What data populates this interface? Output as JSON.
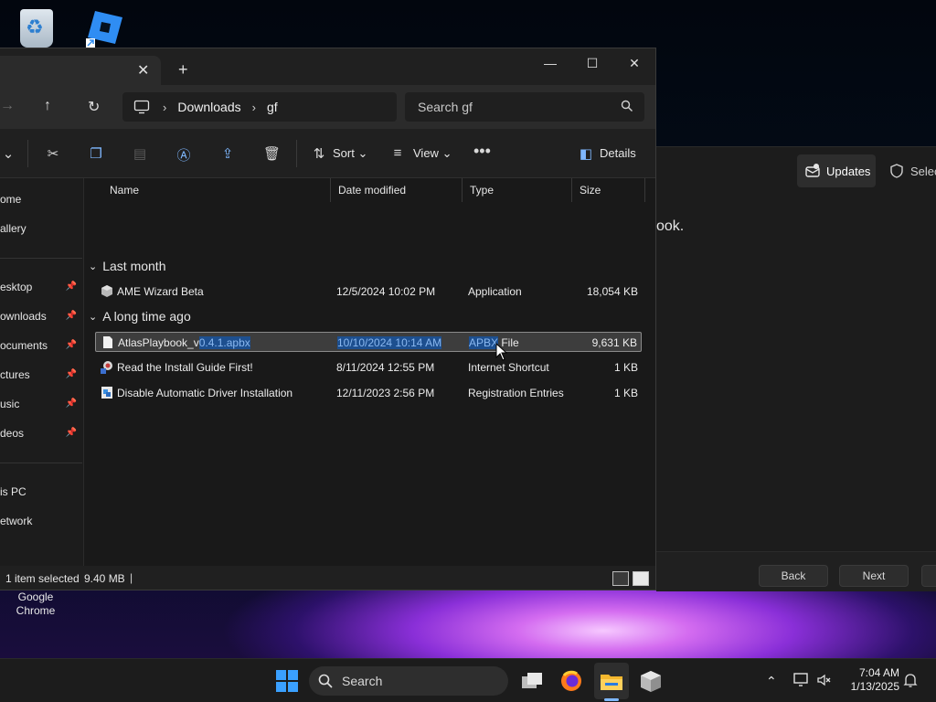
{
  "desktop": {
    "chrome_label_line1": "Google",
    "chrome_label_line2": "Chrome"
  },
  "background_window": {
    "tab_updates": "Updates",
    "tab_select": "Selec",
    "body_text": "ook.",
    "back_button": "Back",
    "next_button": "Next"
  },
  "explorer": {
    "tab_close": "✕",
    "tab_new": "+",
    "address": {
      "crumbs": [
        "Downloads",
        "gf"
      ],
      "search_placeholder": "Search gf"
    },
    "toolbar": {
      "sort_label": "Sort",
      "view_label": "View",
      "details_label": "Details"
    },
    "sidebar": [
      {
        "label": "ome",
        "pinned": false
      },
      {
        "label": "allery",
        "pinned": false
      },
      {
        "label": "esktop",
        "pinned": true
      },
      {
        "label": "ownloads",
        "pinned": true
      },
      {
        "label": "ocuments",
        "pinned": true
      },
      {
        "label": "ctures",
        "pinned": true
      },
      {
        "label": "usic",
        "pinned": true
      },
      {
        "label": "deos",
        "pinned": true
      },
      {
        "label": "is PC",
        "pinned": false
      },
      {
        "label": "etwork",
        "pinned": false
      }
    ],
    "columns": {
      "name": "Name",
      "date": "Date modified",
      "type": "Type",
      "size": "Size"
    },
    "groups": [
      {
        "title": "Last month",
        "files": [
          {
            "name": "AME Wizard Beta",
            "date": "12/5/2024 10:02 PM",
            "type": "Application",
            "size": "18,054 KB",
            "icon": "cube-icon"
          }
        ]
      },
      {
        "title": "A long time ago",
        "files": [
          {
            "name_prefix": "AtlasPlaybook_v",
            "name_hl": "0.4.1.apbx",
            "date": "10/10/2024 10:14 AM",
            "type_hl": "APBX",
            "type_rest": " File",
            "size": "9,631 KB",
            "icon": "file-icon",
            "selected": true
          },
          {
            "name": "Read the Install Guide First!",
            "date": "8/11/2024 12:55 PM",
            "type": "Internet Shortcut",
            "size": "1 KB",
            "icon": "shortcut-icon"
          },
          {
            "name": "Disable Automatic Driver Installation",
            "date": "12/11/2023 2:56 PM",
            "type": "Registration Entries",
            "size": "1 KB",
            "icon": "registry-icon"
          }
        ]
      }
    ],
    "status": {
      "selected_text": "1 item selected",
      "size_text": "9.40 MB"
    }
  },
  "taskbar": {
    "search_label": "Search",
    "time": "7:04 AM",
    "date": "1/13/2025"
  }
}
